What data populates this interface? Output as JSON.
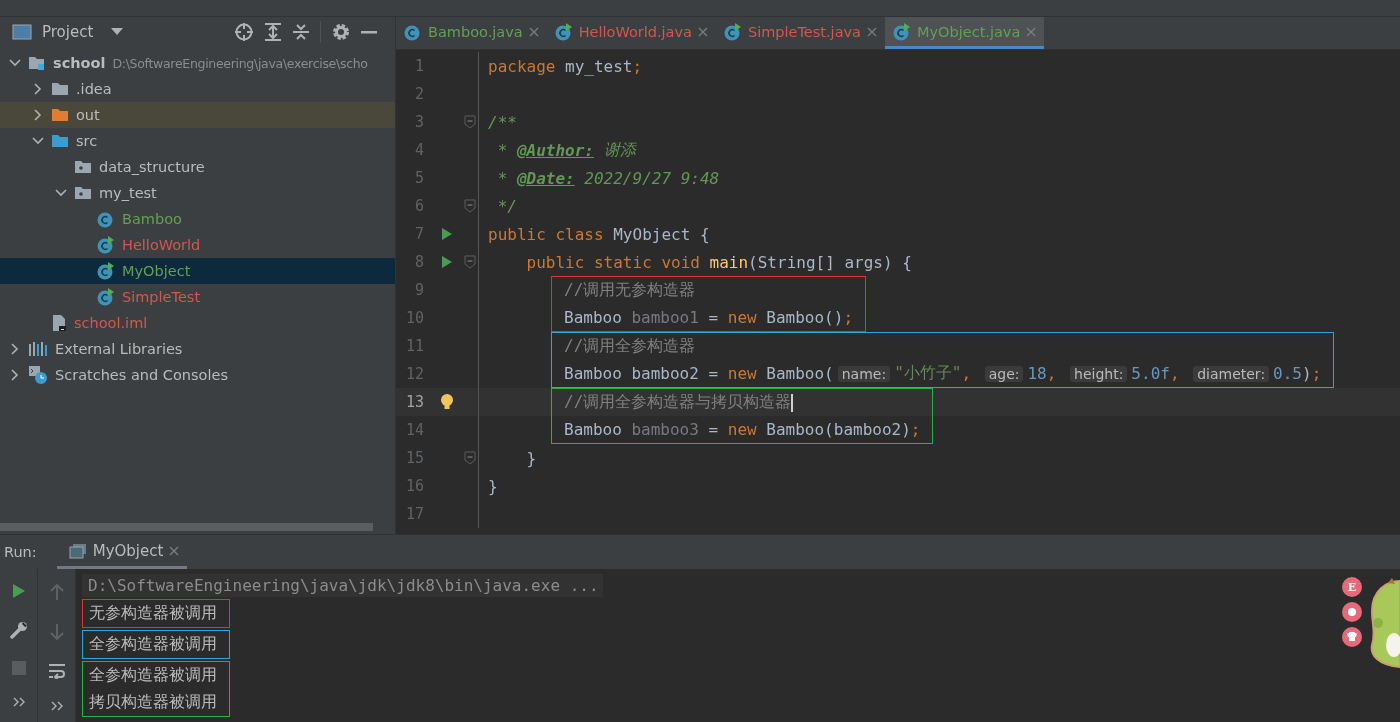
{
  "sidebar": {
    "title": "Project",
    "tree": [
      {
        "label": "school",
        "kind": "module",
        "detail": "D:\\SoftwareEngineering\\java\\exercise\\scho",
        "expanded": true,
        "selected": false,
        "children": [
          {
            "label": ".idea",
            "kind": "folder",
            "expanded": false,
            "selected": false
          },
          {
            "label": "out",
            "kind": "excluded-folder",
            "expanded": false,
            "selected": false
          },
          {
            "label": "src",
            "kind": "source-folder",
            "expanded": true,
            "selected": false,
            "children": [
              {
                "label": "data_structure",
                "kind": "package",
                "selected": false
              },
              {
                "label": "my_test",
                "kind": "package",
                "expanded": true,
                "selected": false,
                "children": [
                  {
                    "label": "Bamboo",
                    "kind": "class",
                    "color": "#62a052",
                    "selected": false
                  },
                  {
                    "label": "HelloWorld",
                    "kind": "runnable-class",
                    "color": "#d0584f",
                    "selected": false
                  },
                  {
                    "label": "MyObject",
                    "kind": "runnable-class",
                    "color": "#62a052",
                    "selected": true
                  },
                  {
                    "label": "SimpleTest",
                    "kind": "runnable-class",
                    "color": "#d0584f",
                    "selected": false
                  }
                ]
              }
            ]
          },
          {
            "label": "school.iml",
            "kind": "module-file",
            "color": "#d0584f",
            "selected": false
          }
        ]
      },
      {
        "label": "External Libraries",
        "kind": "libraries",
        "expanded": false,
        "selected": false
      },
      {
        "label": "Scratches and Consoles",
        "kind": "scratches",
        "expanded": false,
        "selected": false
      }
    ]
  },
  "editor_tabs": [
    {
      "label": "Bamboo.java",
      "kind": "class",
      "color": "#62a052",
      "selected": false
    },
    {
      "label": "HelloWorld.java",
      "kind": "runnable-class",
      "color": "#d0584f",
      "selected": false
    },
    {
      "label": "SimpleTest.java",
      "kind": "runnable-class",
      "color": "#d0584f",
      "selected": false
    },
    {
      "label": "MyObject.java",
      "kind": "runnable-class",
      "color": "#62a052",
      "selected": true
    }
  ],
  "code": [
    {
      "kind": "line",
      "number": "1",
      "tokens": [
        {
          "text": "package",
          "kind": "keyword"
        },
        {
          "text": " my_test",
          "kind": "plain"
        },
        {
          "text": ";",
          "kind": "keyword"
        }
      ]
    },
    {
      "kind": "line",
      "number": "2"
    },
    {
      "kind": "line",
      "number": "3",
      "fold": true,
      "tokens": [
        {
          "text": "/**",
          "kind": "doc"
        }
      ]
    },
    {
      "kind": "line",
      "number": "4",
      "tokens": [
        {
          "text": " * ",
          "kind": "doc"
        },
        {
          "text": "@Author:",
          "kind": "doctag"
        },
        {
          "text": " 谢添",
          "kind": "doc"
        }
      ]
    },
    {
      "kind": "line",
      "number": "5",
      "tokens": [
        {
          "text": " * ",
          "kind": "doc"
        },
        {
          "text": "@Date:",
          "kind": "doctag"
        },
        {
          "text": " 2022/9/27 9:48",
          "kind": "doc"
        }
      ]
    },
    {
      "kind": "line",
      "number": "6",
      "fold": true,
      "tokens": [
        {
          "text": " */",
          "kind": "doc"
        }
      ]
    },
    {
      "kind": "line",
      "number": "7",
      "run": true,
      "tokens": [
        {
          "text": "public class ",
          "kind": "keyword"
        },
        {
          "text": "MyObject {",
          "kind": "plain"
        }
      ]
    },
    {
      "kind": "line",
      "number": "8",
      "run": true,
      "fold": true,
      "tokens": [
        {
          "text": "    public static void ",
          "kind": "keyword"
        },
        {
          "text": "main",
          "kind": "method"
        },
        {
          "text": "(String[] args) {",
          "kind": "plain"
        }
      ]
    },
    {
      "kind": "box",
      "color": "#e0303a",
      "lines": [
        {
          "number": "9",
          "tokens": [
            {
              "text": "//调用无参构造器",
              "kind": "comment"
            }
          ]
        },
        {
          "number": "10",
          "tokens": [
            {
              "text": "Bamboo ",
              "kind": "plain"
            },
            {
              "text": "bamboo1",
              "kind": "unused"
            },
            {
              "text": " = ",
              "kind": "plain"
            },
            {
              "text": "new ",
              "kind": "keyword"
            },
            {
              "text": "Bamboo()",
              "kind": "plain"
            },
            {
              "text": ";",
              "kind": "keyword"
            }
          ]
        }
      ]
    },
    {
      "kind": "box",
      "color": "#2fa3db",
      "lines": [
        {
          "number": "11",
          "tokens": [
            {
              "text": "//调用全参构造器",
              "kind": "comment"
            }
          ]
        },
        {
          "number": "12",
          "tokens": [
            {
              "text": "Bamboo bamboo2 = ",
              "kind": "plain"
            },
            {
              "text": "new ",
              "kind": "keyword"
            },
            {
              "text": "Bamboo(",
              "kind": "plain"
            },
            {
              "text": "name:",
              "kind": "hint"
            },
            {
              "text": "\"小竹子\"",
              "kind": "string"
            },
            {
              "text": ", ",
              "kind": "keyword"
            },
            {
              "text": "age:",
              "kind": "hint"
            },
            {
              "text": "18",
              "kind": "number"
            },
            {
              "text": ", ",
              "kind": "keyword"
            },
            {
              "text": "height:",
              "kind": "hint"
            },
            {
              "text": "5.0f",
              "kind": "number"
            },
            {
              "text": ", ",
              "kind": "keyword"
            },
            {
              "text": "diameter:",
              "kind": "hint"
            },
            {
              "text": "0.5",
              "kind": "number"
            },
            {
              "text": ")",
              "kind": "plain"
            },
            {
              "text": ";",
              "kind": "keyword"
            }
          ]
        }
      ]
    },
    {
      "kind": "box",
      "color": "#2eae4a",
      "lines": [
        {
          "number": "13",
          "current": true,
          "bulb": true,
          "tokens": [
            {
              "text": "//调用全参构造器与拷贝构造器",
              "kind": "comment"
            }
          ]
        },
        {
          "number": "14",
          "tokens": [
            {
              "text": "Bamboo ",
              "kind": "plain"
            },
            {
              "text": "bamboo3",
              "kind": "unused"
            },
            {
              "text": " = ",
              "kind": "plain"
            },
            {
              "text": "new ",
              "kind": "keyword"
            },
            {
              "text": "Bamboo(bamboo2)",
              "kind": "plain"
            },
            {
              "text": ";",
              "kind": "keyword"
            }
          ]
        }
      ]
    },
    {
      "kind": "line",
      "number": "15",
      "fold": true,
      "tokens": [
        {
          "text": "    }",
          "kind": "plain"
        }
      ]
    },
    {
      "kind": "line",
      "number": "16",
      "tokens": [
        {
          "text": "}",
          "kind": "plain"
        }
      ]
    },
    {
      "kind": "line",
      "number": "17"
    }
  ],
  "run_panel": {
    "label": "Run:",
    "tab": "MyObject",
    "command": "D:\\SoftwareEngineering\\java\\jdk\\jdk8\\bin\\java.exe ...",
    "output": [
      {
        "color": "#e0303a",
        "lines": [
          "无参构造器被调用"
        ]
      },
      {
        "color": "#2fa3db",
        "lines": [
          "全参构造器被调用"
        ]
      },
      {
        "color": "#2eae4a",
        "lines": [
          "全参构造器被调用",
          "拷贝构造器被调用"
        ]
      }
    ]
  },
  "floating_widget": {
    "badge": "E"
  }
}
